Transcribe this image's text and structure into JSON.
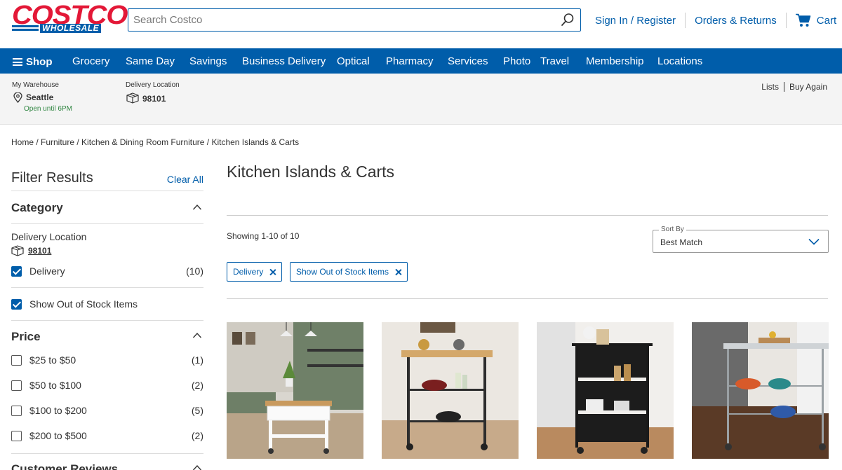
{
  "header": {
    "logo_top": "COSTCO",
    "logo_bottom": "WHOLESALE",
    "search_placeholder": "Search Costco",
    "sign_in": "Sign In / Register",
    "orders": "Orders & Returns",
    "cart": "Cart"
  },
  "nav": {
    "shop": "Shop",
    "items": [
      "Grocery",
      "Same Day",
      "Savings",
      "Business Delivery",
      "Optical",
      "Pharmacy",
      "Services",
      "Photo",
      "Travel",
      "Membership",
      "Locations"
    ]
  },
  "location": {
    "warehouse_label": "My Warehouse",
    "warehouse": "Seattle",
    "open": "Open until 6PM",
    "delivery_label": "Delivery Location",
    "delivery_zip": "98101",
    "lists": "Lists",
    "buy_again": "Buy Again"
  },
  "breadcrumb": "Home / Furniture / Kitchen & Dining Room Furniture / Kitchen Islands & Carts",
  "sidebar": {
    "title": "Filter Results",
    "clear_all": "Clear All",
    "category": {
      "title": "Category",
      "delivery_location_label": "Delivery Location",
      "zip": "98101",
      "delivery": {
        "label": "Delivery",
        "count": "(10)",
        "checked": true
      },
      "out_of_stock": {
        "label": "Show Out of Stock Items",
        "checked": true
      }
    },
    "price": {
      "title": "Price",
      "options": [
        {
          "label": "$25 to $50",
          "count": "(1)",
          "checked": false
        },
        {
          "label": "$50 to $100",
          "count": "(2)",
          "checked": false
        },
        {
          "label": "$100 to $200",
          "count": "(5)",
          "checked": false
        },
        {
          "label": "$200 to $500",
          "count": "(2)",
          "checked": false
        }
      ]
    },
    "reviews": {
      "title": "Customer Reviews"
    }
  },
  "main": {
    "title": "Kitchen Islands & Carts",
    "showing": "Showing 1-10 of 10",
    "sort_label": "Sort By",
    "sort_value": "Best Match",
    "chips": [
      "Delivery",
      "Show Out of Stock Items"
    ]
  },
  "colors": {
    "brand_blue": "#005daa",
    "brand_red": "#e31837",
    "open_green": "#2e8540"
  }
}
